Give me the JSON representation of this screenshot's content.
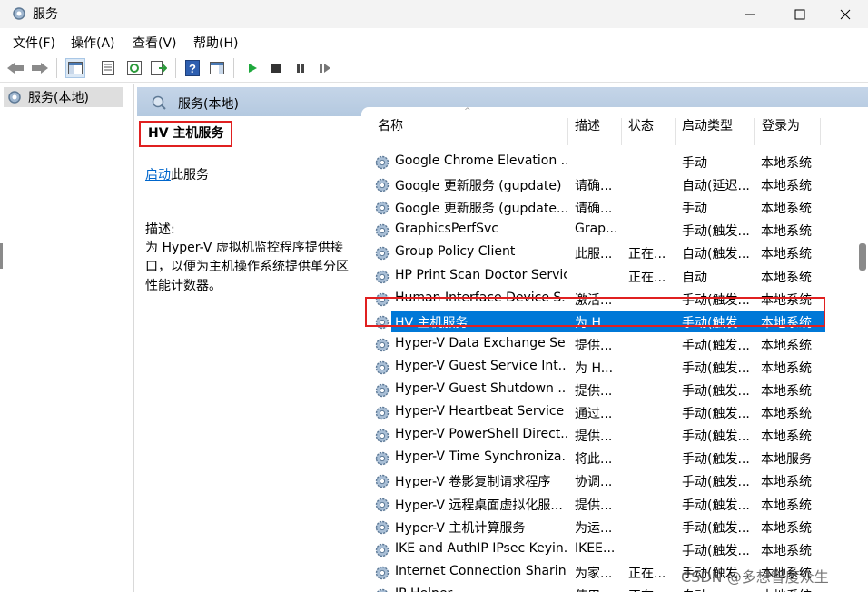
{
  "window": {
    "title": "服务"
  },
  "menu": [
    "文件(F)",
    "操作(A)",
    "查看(V)",
    "帮助(H)"
  ],
  "tree": {
    "item": "服务(本地)"
  },
  "pane": {
    "header": "服务(本地)",
    "service_title": "HV 主机服务",
    "start_link": "启动",
    "start_suffix": "此服务",
    "desc_label": "描述:",
    "desc_text": "为 Hyper-V 虚拟机监控程序提供接口，以便为主机操作系统提供单分区性能计数器。"
  },
  "columns": {
    "name": "名称",
    "desc": "描述",
    "status": "状态",
    "startup": "启动类型",
    "logon": "登录为"
  },
  "rows": [
    {
      "name": "Google Chrome Elevation ...",
      "desc": "",
      "status": "",
      "startup": "手动",
      "logon": "本地系统"
    },
    {
      "name": "Google 更新服务 (gupdate)",
      "desc": "请确...",
      "status": "",
      "startup": "自动(延迟...",
      "logon": "本地系统"
    },
    {
      "name": "Google 更新服务 (gupdate...",
      "desc": "请确...",
      "status": "",
      "startup": "手动",
      "logon": "本地系统"
    },
    {
      "name": "GraphicsPerfSvc",
      "desc": "Grap...",
      "status": "",
      "startup": "手动(触发...",
      "logon": "本地系统"
    },
    {
      "name": "Group Policy Client",
      "desc": "此服...",
      "status": "正在...",
      "startup": "自动(触发...",
      "logon": "本地系统"
    },
    {
      "name": "HP Print Scan Doctor Service",
      "desc": "",
      "status": "正在...",
      "startup": "自动",
      "logon": "本地系统"
    },
    {
      "name": "Human Interface Device S...",
      "desc": "激活...",
      "status": "",
      "startup": "手动(触发...",
      "logon": "本地系统"
    },
    {
      "name": "HV 主机服务",
      "desc": "为 H...",
      "status": "",
      "startup": "手动(触发...",
      "logon": "本地系统"
    },
    {
      "name": "Hyper-V Data Exchange Se...",
      "desc": "提供...",
      "status": "",
      "startup": "手动(触发...",
      "logon": "本地系统"
    },
    {
      "name": "Hyper-V Guest Service Int...",
      "desc": "为 H...",
      "status": "",
      "startup": "手动(触发...",
      "logon": "本地系统"
    },
    {
      "name": "Hyper-V Guest Shutdown ...",
      "desc": "提供...",
      "status": "",
      "startup": "手动(触发...",
      "logon": "本地系统"
    },
    {
      "name": "Hyper-V Heartbeat Service",
      "desc": "通过...",
      "status": "",
      "startup": "手动(触发...",
      "logon": "本地系统"
    },
    {
      "name": "Hyper-V PowerShell Direct...",
      "desc": "提供...",
      "status": "",
      "startup": "手动(触发...",
      "logon": "本地系统"
    },
    {
      "name": "Hyper-V Time Synchroniza...",
      "desc": "将此...",
      "status": "",
      "startup": "手动(触发...",
      "logon": "本地服务"
    },
    {
      "name": "Hyper-V 卷影复制请求程序",
      "desc": "协调...",
      "status": "",
      "startup": "手动(触发...",
      "logon": "本地系统"
    },
    {
      "name": "Hyper-V 远程桌面虚拟化服...",
      "desc": "提供...",
      "status": "",
      "startup": "手动(触发...",
      "logon": "本地系统"
    },
    {
      "name": "Hyper-V 主机计算服务",
      "desc": "为运...",
      "status": "",
      "startup": "手动(触发...",
      "logon": "本地系统"
    },
    {
      "name": "IKE and AuthIP IPsec Keyin...",
      "desc": "IKEE...",
      "status": "",
      "startup": "手动(触发...",
      "logon": "本地系统"
    },
    {
      "name": "Internet Connection Sharin...",
      "desc": "为家...",
      "status": "正在...",
      "startup": "手动(触发...",
      "logon": "本地系统"
    },
    {
      "name": "IP Helper",
      "desc": "使用...",
      "status": "正在...",
      "startup": "自动",
      "logon": "本地系统"
    }
  ],
  "selected_row": 7,
  "watermark": "CSDN @多想智度众生",
  "colors": {
    "selection": "#0078d7",
    "highlight_border": "#e02020",
    "pane_header": "#c5d5e8"
  }
}
